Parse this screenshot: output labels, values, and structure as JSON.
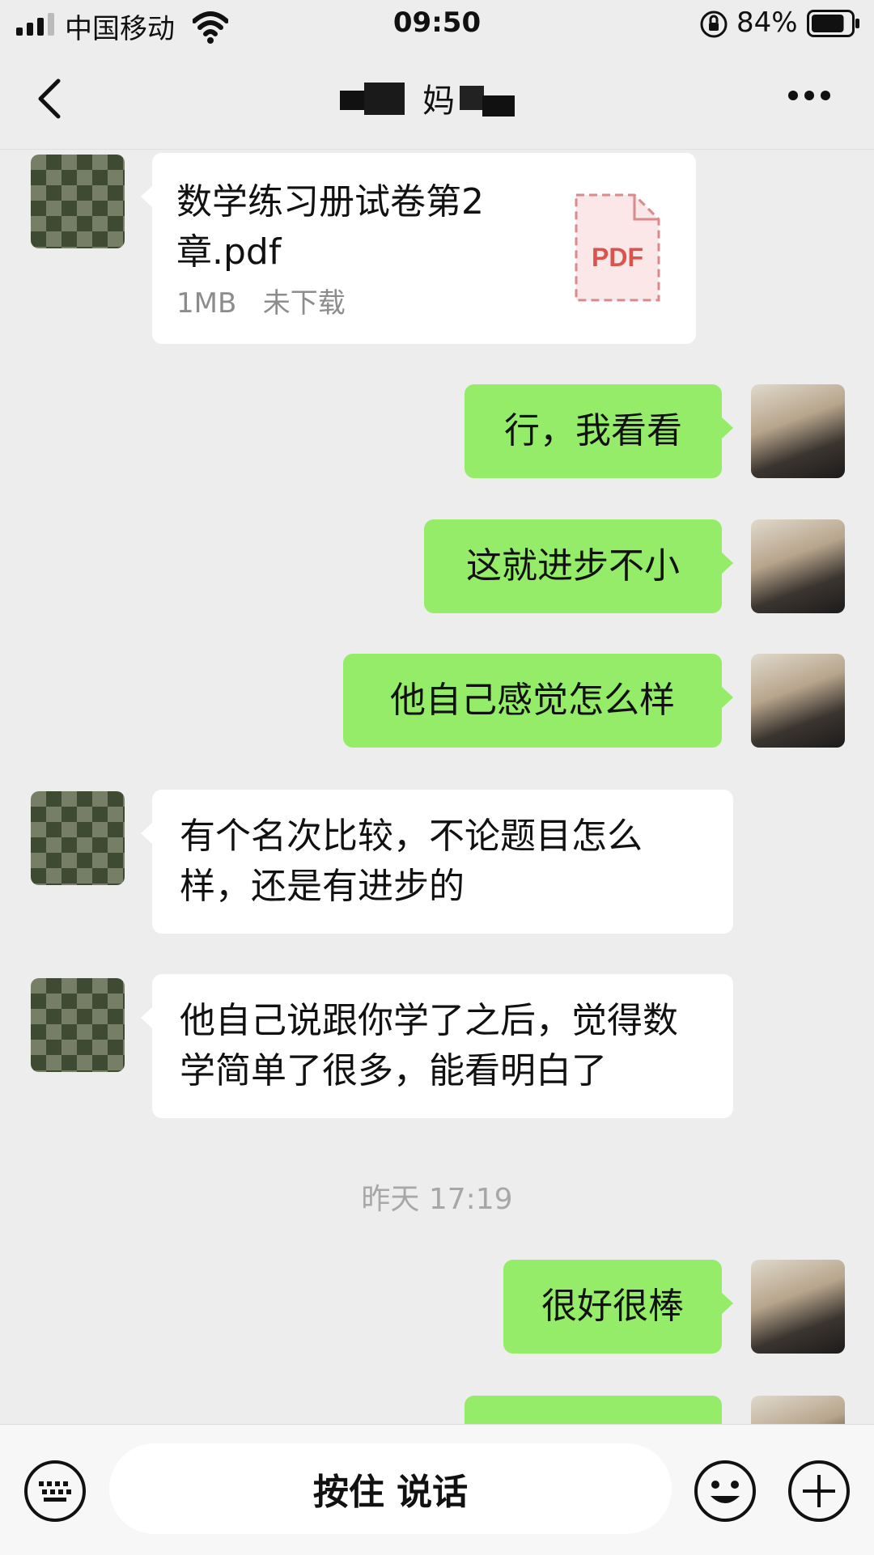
{
  "status_bar": {
    "carrier": "中国移动",
    "time": "09:50",
    "battery_percent": "84%",
    "battery_level": 0.84
  },
  "header": {
    "title_visible_char": "妈",
    "back_icon": "chevron-left-icon",
    "more_icon": "more-dots-icon"
  },
  "messages": [
    {
      "side": "in",
      "type": "file",
      "file_name": "数学练习册试卷第2章.pdf",
      "size": "1MB",
      "status": "未下载",
      "icon_label": "PDF"
    },
    {
      "side": "out",
      "text": "行，我看看"
    },
    {
      "side": "out",
      "text": "这就进步不小"
    },
    {
      "side": "out",
      "text": "他自己感觉怎么样"
    },
    {
      "side": "in",
      "text": "有个名次比较，不论题目怎么样，还是有进步的"
    },
    {
      "side": "in",
      "text": "他自己说跟你学了之后，觉得数学简单了很多，能看明白了"
    },
    {
      "side": "out",
      "text": "很好很棒"
    }
  ],
  "time_separator": "昨天 17:19",
  "input_bar": {
    "hold_to_talk_label": "按住 说话",
    "keyboard_icon": "keyboard-icon",
    "emoji_icon": "emoji-icon",
    "plus_icon": "plus-icon"
  },
  "colors": {
    "background": "#ededed",
    "outgoing_bubble": "#95ec69",
    "incoming_bubble": "#ffffff",
    "pdf_icon": "#d9534f"
  }
}
